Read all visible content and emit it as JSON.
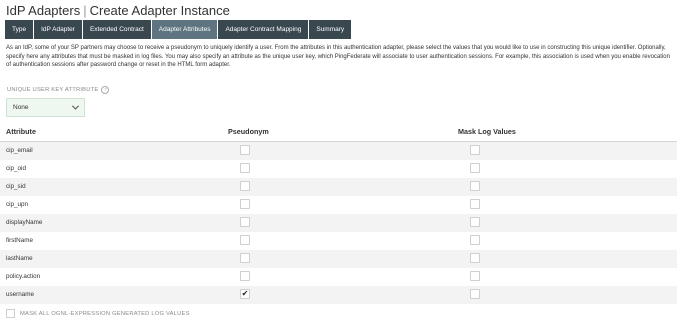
{
  "header": {
    "breadcrumb_root": "IdP Adapters",
    "separator": "|",
    "title": "Create Adapter Instance"
  },
  "tabs": [
    {
      "label": "Type",
      "active": false
    },
    {
      "label": "IdP Adapter",
      "active": false
    },
    {
      "label": "Extended Contract",
      "active": false
    },
    {
      "label": "Adapter Attributes",
      "active": true
    },
    {
      "label": "Adapter Contract Mapping",
      "active": false
    },
    {
      "label": "Summary",
      "active": false
    }
  ],
  "description": "As an IdP, some of your SP partners may choose to receive a pseudonym to uniquely identify a user. From the attributes in this authentication adapter, please select the values that you would like to use in constructing this unique identifier. Optionally, specify here any attributes that must be masked in log files. You may also specify an attribute as the unique user key, which PingFederate will associate to user authentication sessions. For example, this association is used when you enable revocation of authentication sessions after password change or reset in the HTML form adapter.",
  "unique_user_key": {
    "label": "UNIQUE USER KEY ATTRIBUTE",
    "help_glyph": "?",
    "selected": "None"
  },
  "table": {
    "columns": {
      "attribute": "Attribute",
      "pseudonym": "Pseudonym",
      "mask": "Mask Log Values"
    },
    "rows": [
      {
        "attribute": "cip_email",
        "pseudonym": false,
        "mask": false
      },
      {
        "attribute": "cip_oid",
        "pseudonym": false,
        "mask": false
      },
      {
        "attribute": "cip_sid",
        "pseudonym": false,
        "mask": false
      },
      {
        "attribute": "cip_upn",
        "pseudonym": false,
        "mask": false
      },
      {
        "attribute": "displayName",
        "pseudonym": false,
        "mask": false
      },
      {
        "attribute": "firstName",
        "pseudonym": false,
        "mask": false
      },
      {
        "attribute": "lastName",
        "pseudonym": false,
        "mask": false
      },
      {
        "attribute": "policy.action",
        "pseudonym": false,
        "mask": false
      },
      {
        "attribute": "username",
        "pseudonym": true,
        "mask": false
      }
    ]
  },
  "footer": {
    "mask_all_label": "MASK ALL OGNL-EXPRESSION GENERATED LOG VALUES",
    "mask_all_checked": false
  },
  "colors": {
    "tab_bg": "#39474f",
    "tab_active_bg": "#5e7480",
    "row_alt_bg": "#f3f3f3",
    "select_bg": "#eef7f0"
  },
  "icons": {
    "help": "question-circle-icon",
    "dropdown": "chevron-down-icon",
    "check": "checkmark-icon"
  }
}
